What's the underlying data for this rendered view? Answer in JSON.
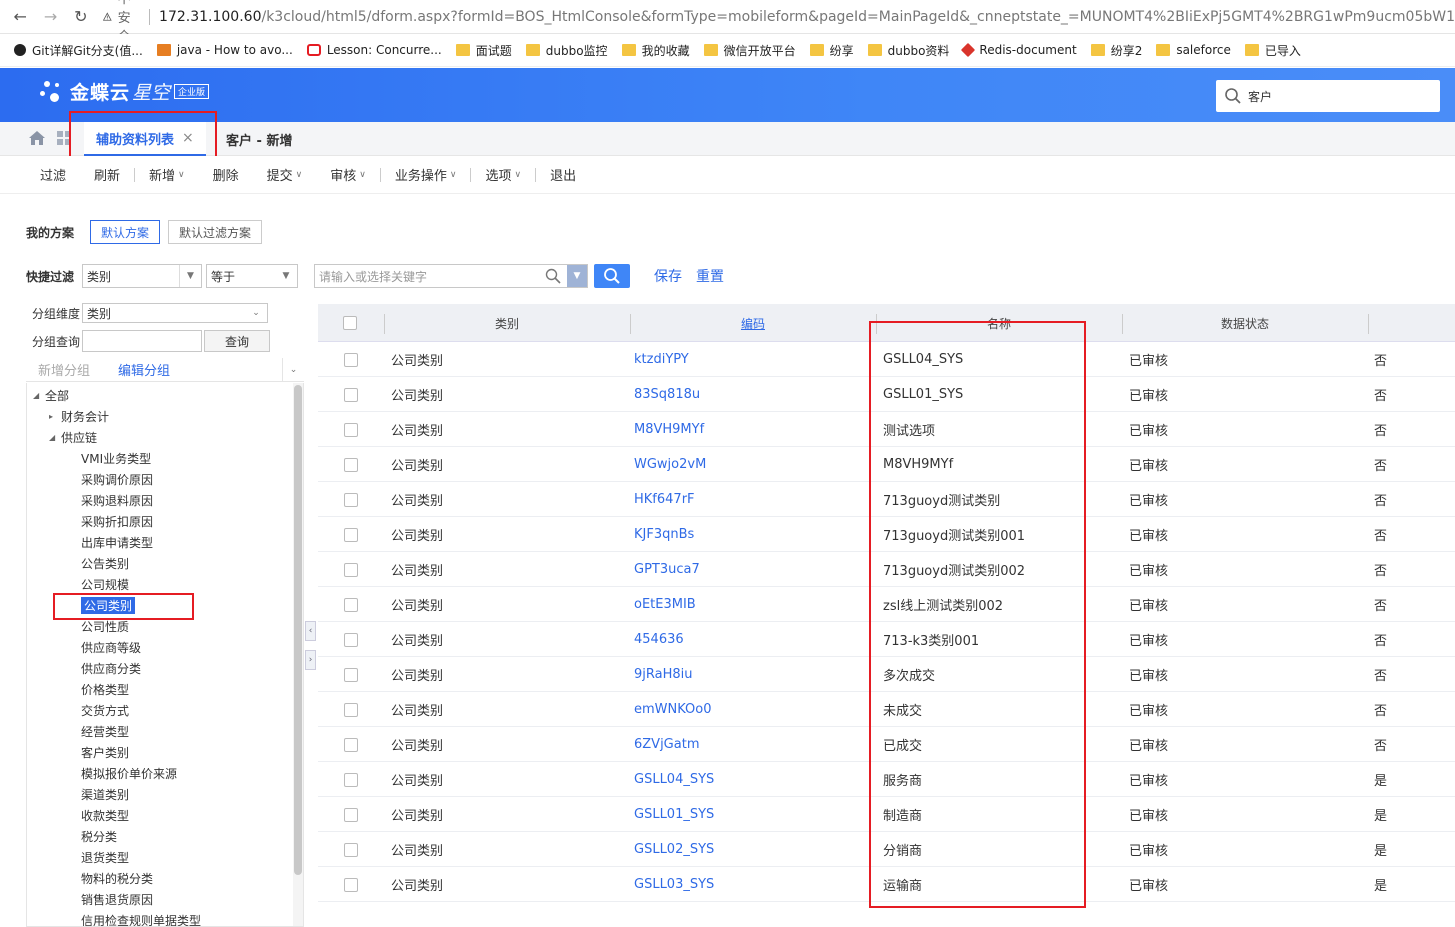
{
  "browser": {
    "insecure_label": "不安全",
    "url_host": "172.31.100.60",
    "url_rest": "/k3cloud/html5/dform.aspx?formId=BOS_HtmlConsole&formType=mobileform&pageId=MainPageId&_cnneptstate_=MUNOMT4%2BIiExPj5GMT4%2BRG1wPm9ucm05bW1",
    "bookmarks": [
      "Git详解Git分支(值...",
      "java - How to avo...",
      "Lesson: Concurre...",
      "面试题",
      "dubbo监控",
      "我的收藏",
      "微信开放平台",
      "纷享",
      "dubbo资料",
      "Redis-document",
      "纷享2",
      "saleforce",
      "已导入"
    ]
  },
  "app": {
    "logo_main": "金蝶云",
    "logo_sub": "星空",
    "logo_badge": "企业版",
    "search_value": "客户"
  },
  "tabs": {
    "active": "辅助资料列表",
    "second": "客户 - 新增"
  },
  "toolbar": [
    "过滤",
    "刷新",
    "新增",
    "删除",
    "提交",
    "审核",
    "业务操作",
    "选项",
    "退出"
  ],
  "filters": {
    "scheme_label": "我的方案",
    "scheme_default": "默认方案",
    "scheme_filter": "默认过滤方案",
    "quick_label": "快捷过滤",
    "field": "类别",
    "operator": "等于",
    "keyword_placeholder": "请输入或选择关键字",
    "save": "保存",
    "reset": "重置"
  },
  "group_panel": {
    "dimension_label": "分组维度",
    "dimension_value": "类别",
    "query_label": "分组查询",
    "query_button": "查询",
    "add_group": "新增分组",
    "edit_group": "编辑分组",
    "tree": [
      {
        "label": "全部",
        "level": 0,
        "arrow": "◢"
      },
      {
        "label": "财务会计",
        "level": 1,
        "arrow": "▸"
      },
      {
        "label": "供应链",
        "level": 1,
        "arrow": "◢"
      },
      {
        "label": "VMI业务类型",
        "level": 2
      },
      {
        "label": "采购调价原因",
        "level": 2
      },
      {
        "label": "采购退料原因",
        "level": 2
      },
      {
        "label": "采购折扣原因",
        "level": 2
      },
      {
        "label": "出库申请类型",
        "level": 2
      },
      {
        "label": "公告类别",
        "level": 2
      },
      {
        "label": "公司规模",
        "level": 2
      },
      {
        "label": "公司类别",
        "level": 2,
        "selected": true
      },
      {
        "label": "公司性质",
        "level": 2
      },
      {
        "label": "供应商等级",
        "level": 2
      },
      {
        "label": "供应商分类",
        "level": 2
      },
      {
        "label": "价格类型",
        "level": 2
      },
      {
        "label": "交货方式",
        "level": 2
      },
      {
        "label": "经营类型",
        "level": 2
      },
      {
        "label": "客户类别",
        "level": 2
      },
      {
        "label": "模拟报价单价来源",
        "level": 2
      },
      {
        "label": "渠道类别",
        "level": 2
      },
      {
        "label": "收款类型",
        "level": 2
      },
      {
        "label": "税分类",
        "level": 2
      },
      {
        "label": "退货类型",
        "level": 2
      },
      {
        "label": "物料的税分类",
        "level": 2
      },
      {
        "label": "销售退货原因",
        "level": 2
      },
      {
        "label": "信用检查规则单据类型",
        "level": 2
      }
    ]
  },
  "grid": {
    "columns": [
      "类别",
      "编码",
      "名称",
      "数据状态"
    ],
    "rows": [
      {
        "category": "公司类别",
        "code": "ktzdiYPY",
        "name": "GSLL04_SYS",
        "status": "已审核",
        "flag": "否"
      },
      {
        "category": "公司类别",
        "code": "83Sq818u",
        "name": "GSLL01_SYS",
        "status": "已审核",
        "flag": "否"
      },
      {
        "category": "公司类别",
        "code": "M8VH9MYf",
        "name": "测试选项",
        "status": "已审核",
        "flag": "否"
      },
      {
        "category": "公司类别",
        "code": "WGwjo2vM",
        "name": "M8VH9MYf",
        "status": "已审核",
        "flag": "否"
      },
      {
        "category": "公司类别",
        "code": "HKf647rF",
        "name": "713guoyd测试类别",
        "status": "已审核",
        "flag": "否"
      },
      {
        "category": "公司类别",
        "code": "KJF3qnBs",
        "name": "713guoyd测试类别001",
        "status": "已审核",
        "flag": "否"
      },
      {
        "category": "公司类别",
        "code": "GPT3uca7",
        "name": "713guoyd测试类别002",
        "status": "已审核",
        "flag": "否"
      },
      {
        "category": "公司类别",
        "code": "oEtE3MIB",
        "name": "zsl线上测试类别002",
        "status": "已审核",
        "flag": "否"
      },
      {
        "category": "公司类别",
        "code": "454636",
        "name": "713-k3类别001",
        "status": "已审核",
        "flag": "否"
      },
      {
        "category": "公司类别",
        "code": "9jRaH8iu",
        "name": "多次成交",
        "status": "已审核",
        "flag": "否"
      },
      {
        "category": "公司类别",
        "code": "emWNKOo0",
        "name": "未成交",
        "status": "已审核",
        "flag": "否"
      },
      {
        "category": "公司类别",
        "code": "6ZVjGatm",
        "name": "已成交",
        "status": "已审核",
        "flag": "否"
      },
      {
        "category": "公司类别",
        "code": "GSLL04_SYS",
        "name": "服务商",
        "status": "已审核",
        "flag": "是"
      },
      {
        "category": "公司类别",
        "code": "GSLL01_SYS",
        "name": "制造商",
        "status": "已审核",
        "flag": "是"
      },
      {
        "category": "公司类别",
        "code": "GSLL02_SYS",
        "name": "分销商",
        "status": "已审核",
        "flag": "是"
      },
      {
        "category": "公司类别",
        "code": "GSLL03_SYS",
        "name": "运输商",
        "status": "已审核",
        "flag": "是"
      }
    ]
  },
  "colors": {
    "accent": "#2f6ae6",
    "highlight_box": "#e51c23",
    "header_blue": "#3f86f7"
  }
}
